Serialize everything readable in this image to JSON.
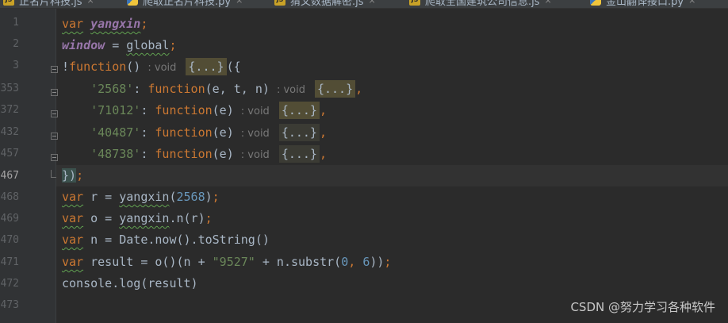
{
  "tabs": [
    {
      "label": "正名片科技.js",
      "icon": "js-file-icon"
    },
    {
      "label": "爬取正名片科技.py",
      "icon": "python-file-icon"
    },
    {
      "label": "猜文数据解密.js",
      "icon": "js-file-icon"
    },
    {
      "label": "爬取全国建筑公司信息.js",
      "icon": "js-file-icon"
    },
    {
      "label": "金山翻译接口.py",
      "icon": "python-file-icon"
    }
  ],
  "line_numbers": [
    "1",
    "2",
    "3",
    "353",
    "372",
    "432",
    "457",
    "467",
    "468",
    "469",
    "470",
    "471",
    "472",
    "473"
  ],
  "code": {
    "l1": {
      "kw": "var",
      "name": "yangxin",
      "end": ";"
    },
    "l2": {
      "name": "window",
      "op": " = ",
      "val": "global",
      "end": ";"
    },
    "l3": {
      "pre": "!",
      "kw": "function",
      "paren": "()",
      "hint": ": void",
      "fold": "{...}",
      "post": "({"
    },
    "l4": {
      "str": "'2568'",
      "colon": ": ",
      "kw": "function",
      "params": "(e, t, n)",
      "hint": ": void",
      "fold": "{...}",
      "end": ","
    },
    "l5": {
      "str": "'71012'",
      "colon": ": ",
      "kw": "function",
      "params": "(e)",
      "hint": ": void",
      "fold": "{...}",
      "end": ","
    },
    "l6": {
      "str": "'40487'",
      "colon": ": ",
      "kw": "function",
      "params": "(e)",
      "hint": ": void",
      "fold": "{...}",
      "end": ","
    },
    "l7": {
      "str": "'48738'",
      "colon": ": ",
      "kw": "function",
      "params": "(e)",
      "hint": ": void",
      "fold": "{...}",
      "end": ","
    },
    "l8": {
      "text": "})",
      "end": ";"
    },
    "l9": {
      "kw": "var",
      "rest": " r = ",
      "fn": "yangxin",
      "open": "(",
      "num": "2568",
      "close": ")",
      "end": ";"
    },
    "l10": {
      "kw": "var",
      "rest": " o = ",
      "fn": "yangxin",
      "tail": ".n(r)",
      "end": ";"
    },
    "l11": {
      "kw": "var",
      "rest": " n = Date.now().toString()"
    },
    "l12": {
      "kw": "var",
      "rest": " result = o()(n + ",
      "str": "\"9527\"",
      "mid": " + n.substr(",
      "num1": "0",
      "comma": ", ",
      "num2": "6",
      "close": "))",
      "end": ";"
    },
    "l13": {
      "text": "console.log(result)"
    }
  },
  "watermark": "CSDN @努力学习各种软件"
}
